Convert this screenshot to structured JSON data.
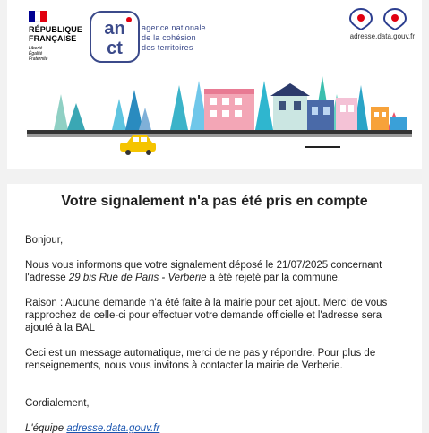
{
  "header": {
    "rf": {
      "name_line1": "RÉPUBLIQUE",
      "name_line2": "FRANÇAISE",
      "motto_1": "Liberté",
      "motto_2": "Égalité",
      "motto_3": "Fraternité"
    },
    "anct": {
      "logo_text": "anct",
      "line1": "agence nationale",
      "line2": "de la cohésion",
      "line3": "des territoires"
    },
    "ban": {
      "url": "adresse.data.gouv.fr",
      "icon": "location-pin-icon"
    },
    "illustration": "town-street-illustration"
  },
  "message": {
    "title": "Votre signalement n'a pas été pris en compte",
    "greeting": "Bonjour,",
    "p1_pre": "Nous vous informons que votre signalement déposé le 21/07/2025 concernant l'adresse ",
    "p1_address": "29 bis Rue de Paris - Verberie",
    "p1_post": " a été rejeté par la commune.",
    "p2": "Raison : Aucune demande n'a été faite à la mairie pour cet ajout. Merci de vous rapprochez de celle-ci pour effectuer votre demande officielle et l'adresse sera ajouté à la BAL",
    "p3": "Ceci est un message automatique, merci de ne pas y répondre. Pour plus de renseignements, nous vous invitons à contacter la mairie de Verberie.",
    "closing": "Cordialement,",
    "signature_pre": "L'équipe ",
    "signature_link": "adresse.data.gouv.fr"
  },
  "colors": {
    "flag_blue": "#000091",
    "flag_red": "#e1000f",
    "link": "#1a55b0",
    "anct_blue": "#3b4a8a",
    "ban_red": "#e1000f"
  }
}
